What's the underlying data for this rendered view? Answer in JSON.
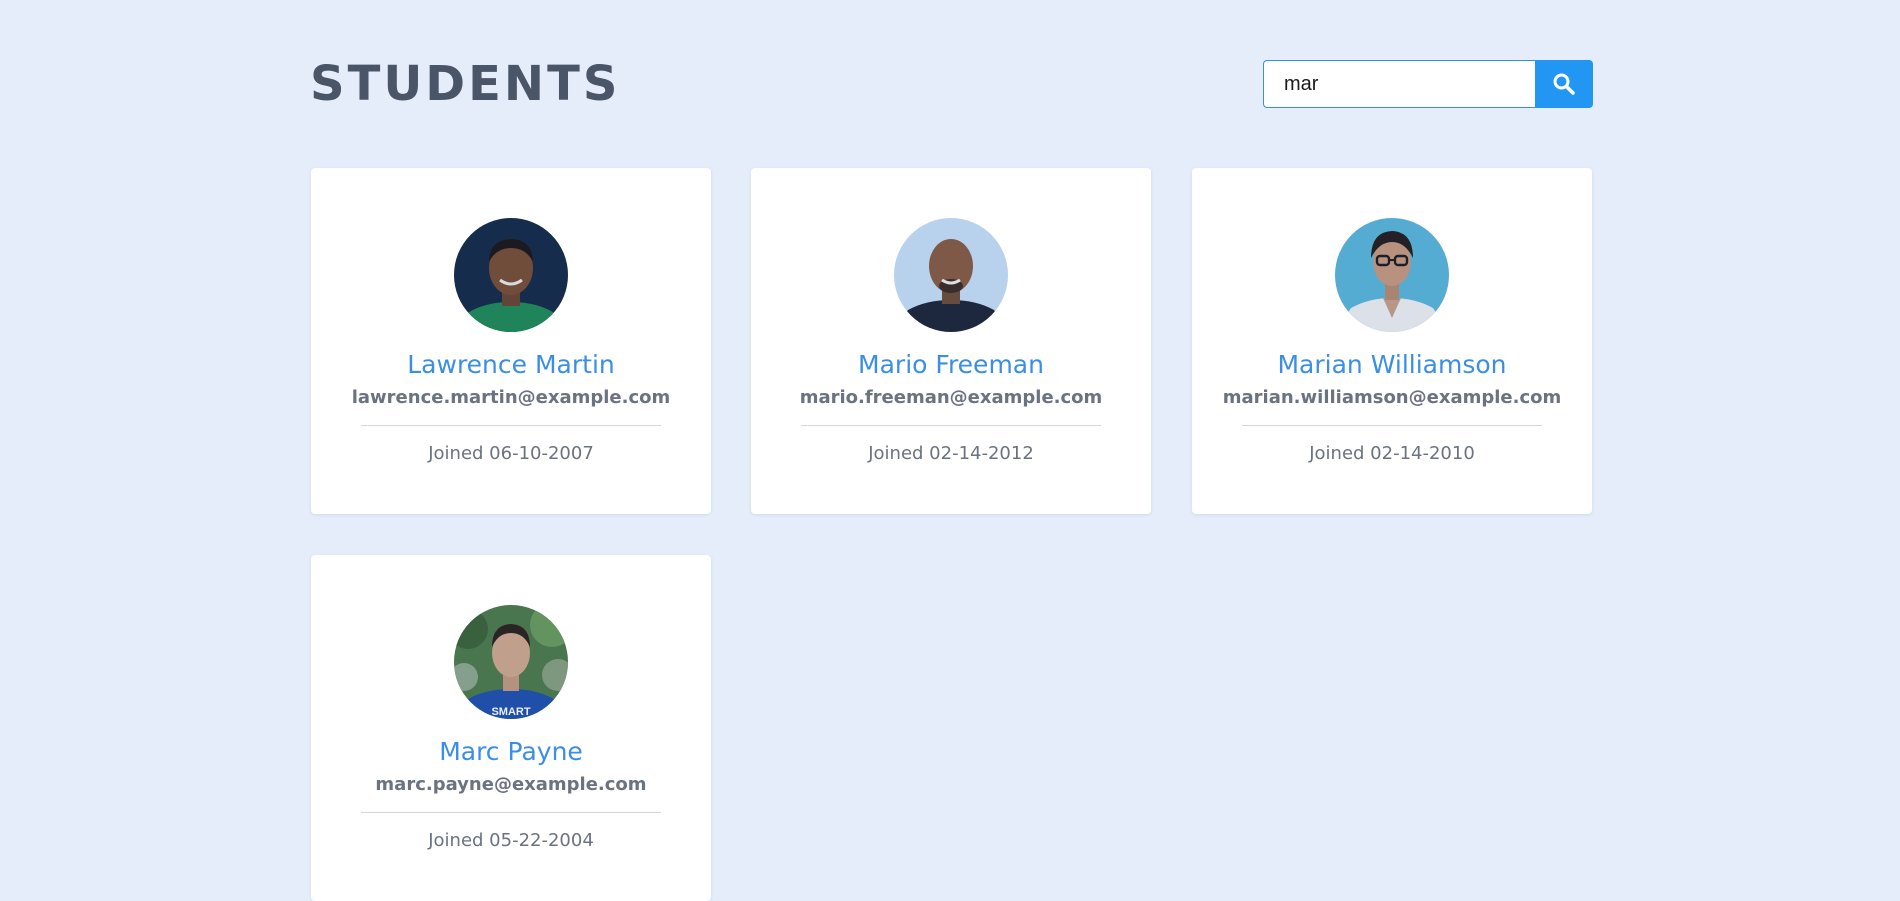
{
  "header": {
    "title": "STUDENTS"
  },
  "search": {
    "value": "mar",
    "button_icon": "search-icon",
    "button_color": "#2196f3"
  },
  "colors": {
    "background": "#e5edfa",
    "name": "#3a8ee6",
    "title": "#4a5568"
  },
  "students": [
    {
      "name": "Lawrence Martin",
      "email": "lawrence.martin@example.com",
      "joined": "Joined 06-10-2007"
    },
    {
      "name": "Mario Freeman",
      "email": "mario.freeman@example.com",
      "joined": "Joined 02-14-2012"
    },
    {
      "name": "Marian Williamson",
      "email": "marian.williamson@example.com",
      "joined": "Joined 02-14-2010"
    },
    {
      "name": "Marc Payne",
      "email": "marc.payne@example.com",
      "joined": "Joined 05-22-2004"
    }
  ]
}
